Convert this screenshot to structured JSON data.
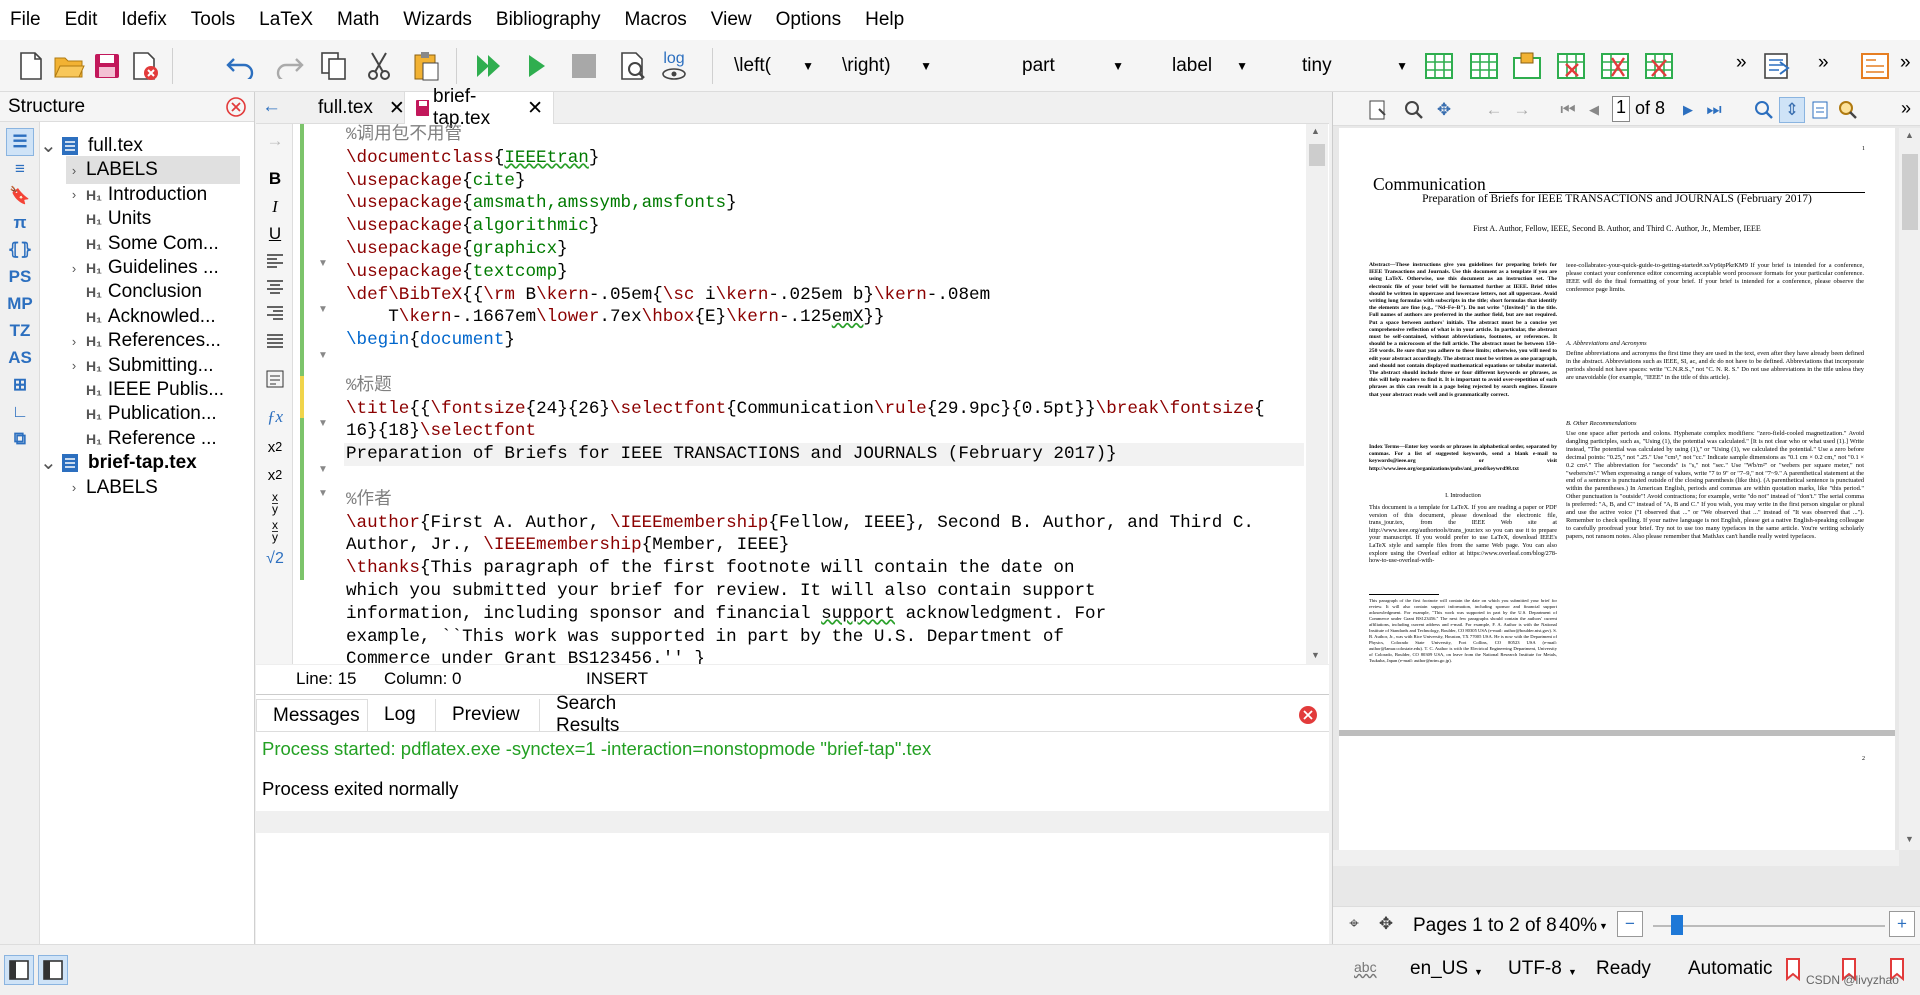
{
  "menu": [
    "File",
    "Edit",
    "Idefix",
    "Tools",
    "LaTeX",
    "Math",
    "Wizards",
    "Bibliography",
    "Macros",
    "View",
    "Options",
    "Help"
  ],
  "toolbar": {
    "left_bracket": "\\left(",
    "right_bracket": "\\right)",
    "sectioning": "part",
    "label": "label",
    "size": "tiny",
    "log_label": "log",
    "more": "»"
  },
  "structure": {
    "title": "Structure",
    "tree": [
      {
        "label": "full.tex",
        "level": 0,
        "expanded": true,
        "type": "file",
        "bold": false
      },
      {
        "label": "LABELS",
        "level": 1,
        "expanded": false,
        "type": "labels",
        "selected": true
      },
      {
        "label": "Introduction",
        "level": 1,
        "expanded": false,
        "type": "h"
      },
      {
        "label": "Units",
        "level": 1,
        "type": "h"
      },
      {
        "label": "Some Com...",
        "level": 1,
        "type": "h"
      },
      {
        "label": "Guidelines ...",
        "level": 1,
        "expanded": false,
        "type": "h"
      },
      {
        "label": "Conclusion",
        "level": 1,
        "type": "h"
      },
      {
        "label": "Acknowled...",
        "level": 1,
        "type": "h"
      },
      {
        "label": "References...",
        "level": 1,
        "expanded": false,
        "type": "h"
      },
      {
        "label": "Submitting...",
        "level": 1,
        "expanded": false,
        "type": "h"
      },
      {
        "label": "IEEE Publis...",
        "level": 1,
        "type": "h"
      },
      {
        "label": "Publication...",
        "level": 1,
        "type": "h"
      },
      {
        "label": "Reference ...",
        "level": 1,
        "type": "h"
      },
      {
        "label": "brief-tap.tex",
        "level": 0,
        "expanded": true,
        "type": "file",
        "bold": true
      },
      {
        "label": "LABELS",
        "level": 1,
        "expanded": false,
        "type": "labels"
      }
    ],
    "h_icon": "H₁",
    "side_icons": [
      "structure-icon",
      "toc-icon",
      "bookmark-icon",
      "pi-icon",
      "brackets-icon",
      "PS",
      "MP",
      "TZ",
      "AS",
      "insert-icon",
      "symbol-icon",
      "tree-icon"
    ]
  },
  "editor": {
    "tabs": [
      {
        "name": "full.tex",
        "active": false
      },
      {
        "name": "brief-tap.tex",
        "active": true
      }
    ],
    "left_buttons": [
      "B",
      "I",
      "U"
    ],
    "status": {
      "line": "Line: 15",
      "column": "Column: 0",
      "mode": "INSERT"
    }
  },
  "code_lines": [
    [
      [
        "%调用包不用管",
        "cm"
      ]
    ],
    [
      [
        "\\documentclass",
        "kw"
      ],
      [
        "{",
        ""
      ],
      [
        "IEEEtran",
        "gr ul"
      ],
      [
        "}",
        ""
      ]
    ],
    [
      [
        "\\usepackage",
        "kw"
      ],
      [
        "{",
        ""
      ],
      [
        "cite",
        "gr"
      ],
      [
        "}",
        ""
      ]
    ],
    [
      [
        "\\usepackage",
        "kw"
      ],
      [
        "{",
        ""
      ],
      [
        "amsmath,amssymb,amsfonts",
        "gr"
      ],
      [
        "}",
        ""
      ]
    ],
    [
      [
        "\\usepackage",
        "kw"
      ],
      [
        "{",
        ""
      ],
      [
        "algorithmic",
        "gr"
      ],
      [
        "}",
        ""
      ]
    ],
    [
      [
        "\\usepackage",
        "kw"
      ],
      [
        "{",
        ""
      ],
      [
        "graphicx",
        "gr"
      ],
      [
        "}",
        ""
      ]
    ],
    [
      [
        "\\usepackage",
        "kw"
      ],
      [
        "{",
        ""
      ],
      [
        "textcomp",
        "gr"
      ],
      [
        "}",
        ""
      ]
    ],
    [
      [
        "\\def",
        "kw"
      ],
      [
        "\\BibTeX",
        "kw"
      ],
      [
        "{{",
        ""
      ],
      [
        "\\rm",
        "kw"
      ],
      [
        " B",
        ""
      ],
      [
        "\\kern",
        "kw"
      ],
      [
        "-.05em{",
        ""
      ],
      [
        "\\sc",
        "kw"
      ],
      [
        " i",
        ""
      ],
      [
        "\\kern",
        "kw"
      ],
      [
        "-.025em b}",
        ""
      ],
      [
        "\\kern",
        "kw"
      ],
      [
        "-.08em",
        ""
      ]
    ],
    [
      [
        "    T",
        ""
      ],
      [
        "\\kern",
        "kw"
      ],
      [
        "-.1667em",
        ""
      ],
      [
        "\\lower",
        "kw"
      ],
      [
        ".7ex",
        ""
      ],
      [
        "\\hbox",
        "kw"
      ],
      [
        "{E}",
        ""
      ],
      [
        "\\kern",
        "kw"
      ],
      [
        "-.125",
        ""
      ],
      [
        "emX",
        "ul"
      ],
      [
        "}}",
        ""
      ]
    ],
    [
      [
        "\\begin",
        "bl"
      ],
      [
        "{",
        ""
      ],
      [
        "document",
        "bl"
      ],
      [
        "}",
        ""
      ]
    ],
    [
      [
        "",
        ""
      ]
    ],
    [
      [
        "%标题",
        "cm"
      ]
    ],
    [
      [
        "\\title",
        "kw"
      ],
      [
        "{{",
        ""
      ],
      [
        "\\fontsize",
        "kw"
      ],
      [
        "{24}{26}",
        ""
      ],
      [
        "\\selectfont",
        "kw"
      ],
      [
        "{Communication",
        ""
      ],
      [
        "\\rule",
        "kw"
      ],
      [
        "{29.9pc}{0.5pt}}",
        ""
      ],
      [
        "\\break",
        "kw"
      ],
      [
        "\\fontsize",
        "kw"
      ],
      [
        "{",
        ""
      ]
    ],
    [
      [
        "16}{18}",
        ""
      ],
      [
        "\\selectfont",
        "kw"
      ]
    ],
    [
      [
        "Preparation of Briefs for IEEE TRANSACTIONS and JOURNALS (February 2017)}",
        ""
      ]
    ],
    [
      [
        "",
        ""
      ]
    ],
    [
      [
        "%作者",
        "cm"
      ]
    ],
    [
      [
        "\\author",
        "kw"
      ],
      [
        "{First A. Author, ",
        ""
      ],
      [
        "\\IEEEmembership",
        "kw"
      ],
      [
        "{Fellow, IEEE}, Second B. Author, and Third C.",
        ""
      ]
    ],
    [
      [
        "Author, Jr., ",
        ""
      ],
      [
        "\\IEEEmembership",
        "kw"
      ],
      [
        "{Member, IEEE}",
        ""
      ]
    ],
    [
      [
        "\\thanks",
        "kw"
      ],
      [
        "{This paragraph of the first footnote will contain the date on",
        ""
      ]
    ],
    [
      [
        "which you submitted your brief for review. It will also contain support",
        ""
      ]
    ],
    [
      [
        "information, including sponsor and financial ",
        ""
      ],
      [
        "support",
        "ul"
      ],
      [
        " acknowledgment. For",
        ""
      ]
    ],
    [
      [
        "example, ``This work was supported in part by the U.S. Department of",
        ""
      ]
    ],
    [
      [
        "Commerce under Grant BS123456.'' }",
        ""
      ]
    ]
  ],
  "messages": {
    "tabs": [
      "Messages",
      "Log",
      "Preview",
      "Search Results"
    ],
    "line1": "Process started: pdflatex.exe -synctex=1 -interaction=nonstopmode \"brief-tap\".tex",
    "line2": "Process exited normally"
  },
  "pdf": {
    "page_input": "1",
    "page_of": "of 8",
    "pages_label": "Pages 1 to 2 of 8",
    "zoom": "40%",
    "page_number": "1",
    "doc": {
      "title": "Communication",
      "subtitle": "Preparation of Briefs for IEEE TRANSACTIONS and JOURNALS (February 2017)",
      "authors": "First A. Author, Fellow, IEEE, Second B. Author, and Third C. Author, Jr., Member, IEEE",
      "col1_abstract": "Abstract—These instructions give you guidelines for preparing briefs for IEEE Transactions and Journals. Use this document as a template if you are using LaTeX. Otherwise, use this document as an instruction set. The electronic file of your brief will be formatted further at IEEE. Brief titles should be written in uppercase and lowercase letters, not all uppercase. Avoid writing long formulas with subscripts in the title; short formulas that identify the elements are fine (e.g., \"Nd–Fe–B\"). Do not write \"(Invited)\" in the title. Full names of authors are preferred in the author field, but are not required. Put a space between authors' initials. The abstract must be a concise yet comprehensive reflection of what is in your article. In particular, the abstract must be self-contained, without abbreviations, footnotes, or references. It should be a microcosm of the full article. The abstract must be between 150–250 words. Be sure that you adhere to these limits; otherwise, you will need to edit your abstract accordingly. The abstract must be written as one paragraph, and should not contain displayed mathematical equations or tabular material. The abstract should include three or four different keywords or phrases, as this will help readers to find it. It is important to avoid over-repetition of such phrases as this can result in a page being rejected by search engines. Ensure that your abstract reads well and is grammatically correct.",
      "col1_index": "Index Terms—Enter key words or phrases in alphabetical order, separated by commas. For a list of suggested keywords, send a blank e-mail to keywords@ieee.org or visit http://www.ieee.org/organizations/pubs/ani_prod/keywrd98.txt",
      "col1_intro_head": "I. Introduction",
      "col1_intro": "This document is a template for LaTeX. If you are reading a paper or PDF version of this document, please download the electronic file, trans_jour.tex, from the IEEE Web site at http://www.ieee.org/authortools/trans_jour.tex so you can use it to prepare your manuscript. If you would prefer to use LaTeX, download IEEE's LaTeX style and sample files from the same Web page. You can also explore using the Overleaf editor at https://www.overleaf.com/blog/278-how-to-use-overleaf-with-",
      "col1_foot": "This paragraph of the first footnote will contain the date on which you submitted your brief for review. It will also contain support information, including sponsor and financial support acknowledgment. For example, \"This work was supported in part by the U.S. Department of Commerce under Grant BS123456.\" The next few paragraphs should contain the authors' current affiliations, including current address and e-mail. For example, F. A. Author is with the National Institute of Standards and Technology, Boulder, CO 80305 USA (e-mail: author@boulder.nist.gov). S. B. Author, Jr., was with Rice University, Houston, TX 77005 USA. He is now with the Department of Physics, Colorado State University, Fort Collins, CO 80523 USA (e-mail: author@lamar.colostate.edu). T. C. Author is with the Electrical Engineering Department, University of Colorado, Boulder, CO 80309 USA, on leave from the National Research Institute for Metals, Tsukuba, Japan (e-mail: author@nrim.go.jp).",
      "col2_a": "ieee-collabratec-your-quick-guide-to-getting-started#.xsVp6tpPkrKM9 If your brief is intended for a conference, please contact your conference editor concerning acceptable word processor formats for your particular conference. IEEE will do the final formatting of your brief. If your brief is intended for a conference, please observe the conference page limits.",
      "col2_h1": "A. Abbreviations and Acronyms",
      "col2_b": "Define abbreviations and acronyms the first time they are used in the text, even after they have already been defined in the abstract. Abbreviations such as IEEE, SI, ac, and dc do not have to be defined. Abbreviations that incorporate periods should not have spaces: write \"C.N.R.S.,\" not \"C. N. R. S.\" Do not use abbreviations in the title unless they are unavoidable (for example, \"IEEE\" in the title of this article).",
      "col2_h2": "B. Other Recommendations",
      "col2_c": "Use one space after periods and colons. Hyphenate complex modifiers: \"zero-field-cooled magnetization.\" Avoid dangling participles, such as, \"Using (1), the potential was calculated.\" [It is not clear who or what used (1).] Write instead, \"The potential was calculated by using (1),\" or \"Using (1), we calculated the potential.\" Use a zero before decimal points: \"0.25,\" not \".25.\" Use \"cm³,\" not \"cc.\" Indicate sample dimensions as \"0.1 cm × 0.2 cm,\" not \"0.1 × 0.2 cm².\" The abbreviation for \"seconds\" is \"s,\" not \"sec.\" Use \"Wb/m²\" or \"webers per square meter,\" not \"webers/m².\" When expressing a range of values, write \"7 to 9\" or \"7–9,\" not \"7~9.\" A parenthetical statement at the end of a sentence is punctuated outside of the closing parenthesis (like this). (A parenthetical sentence is punctuated within the parentheses.) In American English, periods and commas are within quotation marks, like \"this period.\" Other punctuation is \"outside\"! Avoid contractions; for example, write \"do not\" instead of \"don't.\" The serial comma is preferred: \"A, B, and C\" instead of \"A, B and C.\" If you wish, you may write in the first person singular or plural and use the active voice (\"I observed that ...\" or \"We observed that ...\" instead of \"It was observed that ...\"). Remember to check spelling. If your native language is not English, please get a native English-speaking colleague to carefully proofread your brief. Try not to use too many typefaces in the same article. You're writing scholarly papers, not ransom notes. Also please remember that MathJax can't handle really weird typefaces.",
      "page_num_bottom": "2"
    }
  },
  "statusbar": {
    "spell": "abc",
    "lang": "en_US",
    "encoding": "UTF-8",
    "state": "Ready",
    "mode": "Automatic",
    "watermark": "CSDN @livyzhao"
  }
}
